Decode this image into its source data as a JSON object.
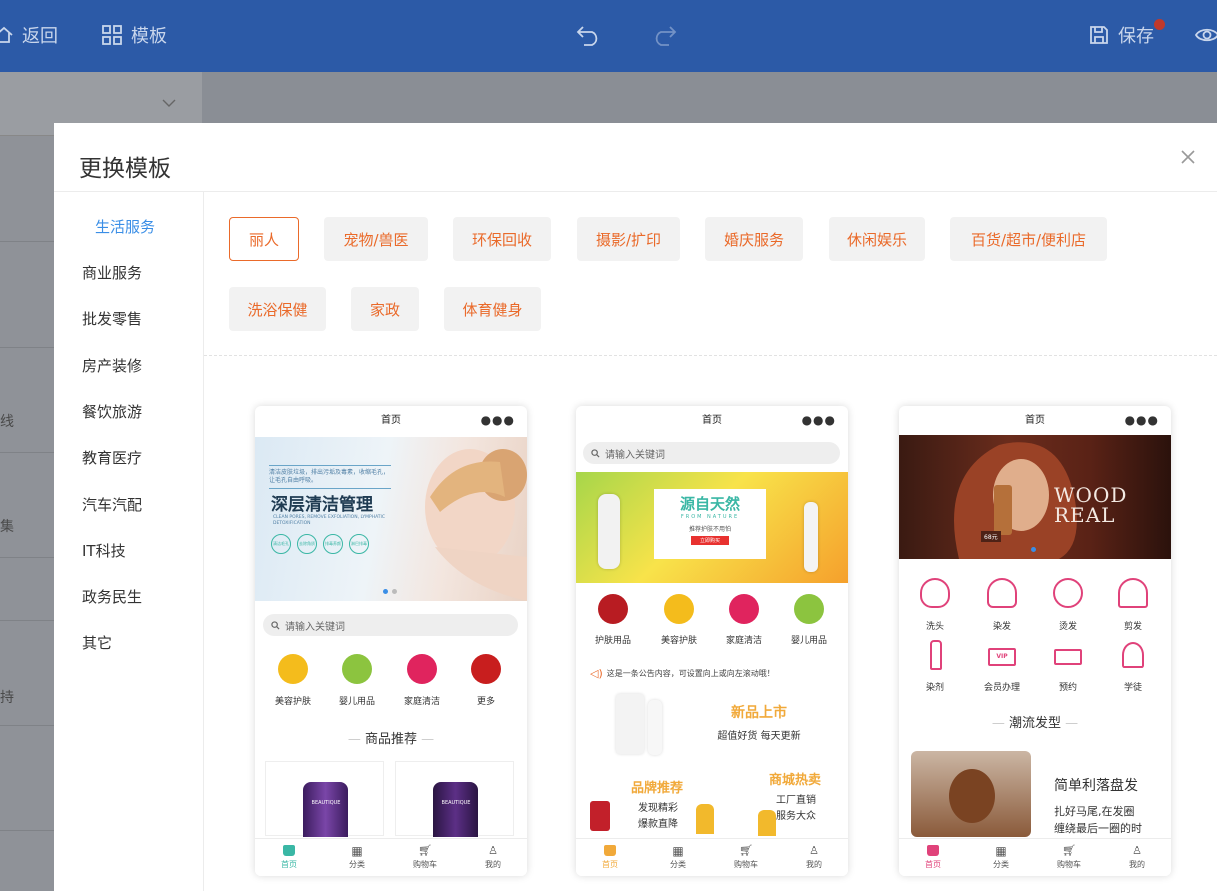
{
  "topbar": {
    "back": "返回",
    "template": "模板",
    "save": "保存"
  },
  "background": {
    "fragments": [
      "线",
      "集",
      "持"
    ]
  },
  "modal": {
    "title": "更换模板",
    "categories": [
      "生活服务",
      "商业服务",
      "批发零售",
      "房产装修",
      "餐饮旅游",
      "教育医疗",
      "汽车汽配",
      "IT科技",
      "政务民生",
      "其它"
    ],
    "tags": [
      "丽人",
      "宠物/兽医",
      "环保回收",
      "摄影/扩印",
      "婚庆服务",
      "休闲娱乐",
      "百货/超市/便利店",
      "洗浴保健",
      "家政",
      "体育健身"
    ]
  },
  "phones": [
    {
      "header": "首页",
      "banner_small": "清洁皮肤垃圾，排出污垢及毒素，收缩毛孔，让毛孔自由呼吸。",
      "banner_title": "深层清洁管理",
      "banner_en": "CLEAN PORES, REMOVE EXFOLIATION, LYMPHATIC DETOXIFICATION",
      "banner_circles": [
        "清洁毛孔",
        "去除角质",
        "排毒养颜",
        "淋巴排毒"
      ],
      "search": "请输入关键词",
      "icons": [
        "美容护肤",
        "婴儿用品",
        "家庭清洁",
        "更多"
      ],
      "section": "商品推荐",
      "product_label": "BEAUTIQUE",
      "tabs": [
        "首页",
        "分类",
        "购物车",
        "我的"
      ]
    },
    {
      "header": "首页",
      "search": "请输入关键词",
      "banner_title": "源自天然",
      "banner_en": "FROM NATURE",
      "banner_sub": "推荐护肤不用怕",
      "banner_btn": "立即购买",
      "icons": [
        "护肤用品",
        "美容护肤",
        "家庭清洁",
        "婴儿用品"
      ],
      "notice": "这是一条公告内容，可设置向上或向左滚动哦！",
      "new_title": "新品上市",
      "new_sub": "超值好货 每天更新",
      "brand_title": "品牌推荐",
      "brand_sub1": "发现精彩",
      "brand_sub2": "爆款直降",
      "hot_title": "商城热卖",
      "hot_sub1": "工厂直销",
      "hot_sub2": "服务大众",
      "tabs": [
        "首页",
        "分类",
        "购物车",
        "我的"
      ]
    },
    {
      "header": "首页",
      "banner_title1": "WOOD",
      "banner_title2": "REAL",
      "banner_price": "68元",
      "icons": [
        "洗头",
        "染发",
        "烫发",
        "剪发",
        "染剂",
        "会员办理",
        "预约",
        "学徒"
      ],
      "vip_label": "VIP",
      "section": "潮流发型",
      "card_title": "简单利落盘发",
      "card_desc1": "扎好马尾,在发圈",
      "card_desc2": "缠绕最后一圈的时",
      "tabs": [
        "首页",
        "分类",
        "购物车",
        "我的"
      ]
    }
  ],
  "colors": {
    "topbar": "#2c5aa7",
    "accent_orange": "#ea6a2a",
    "active_blue": "#3a8ee6",
    "pink": "#e0427a",
    "gold": "#f1a93a",
    "teal": "#3ab7a5"
  }
}
